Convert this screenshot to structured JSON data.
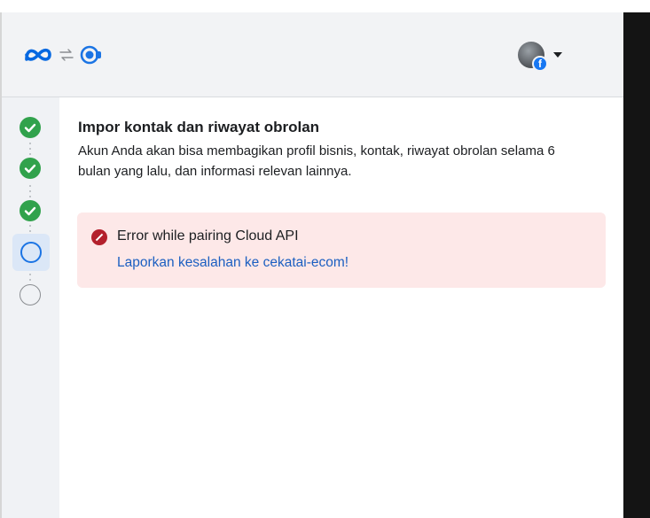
{
  "header": {
    "logos": [
      "meta-logo-icon",
      "sync-arrows-icon",
      "cloud-api-logo-icon"
    ],
    "account": {
      "avatar": "profile-avatar",
      "badge": "facebook-badge-icon",
      "badge_glyph": "f",
      "menu_icon": "caret-down-icon"
    }
  },
  "steps": [
    {
      "status": "completed"
    },
    {
      "status": "completed"
    },
    {
      "status": "completed"
    },
    {
      "status": "current"
    },
    {
      "status": "pending"
    }
  ],
  "main": {
    "title": "Impor kontak dan riwayat obrolan",
    "description": "Akun Anda akan bisa membagikan profil bisnis, kontak, riwayat obrolan selama 6 bulan yang lalu, dan informasi relevan lainnya.",
    "alert": {
      "icon": "error-icon",
      "message": "Error while pairing Cloud API",
      "link_text": "Laporkan kesalahan ke cekatai-ecom!"
    }
  },
  "colors": {
    "header_bg": "#f2f3f5",
    "sidebar_bg": "#f0f2f5",
    "step_done": "#31a24c",
    "step_active": "#1b74e4",
    "alert_bg": "#fde8e8",
    "error_red": "#b3202c",
    "link_blue": "#1b5fc1",
    "meta_blue": "#0668e1"
  }
}
